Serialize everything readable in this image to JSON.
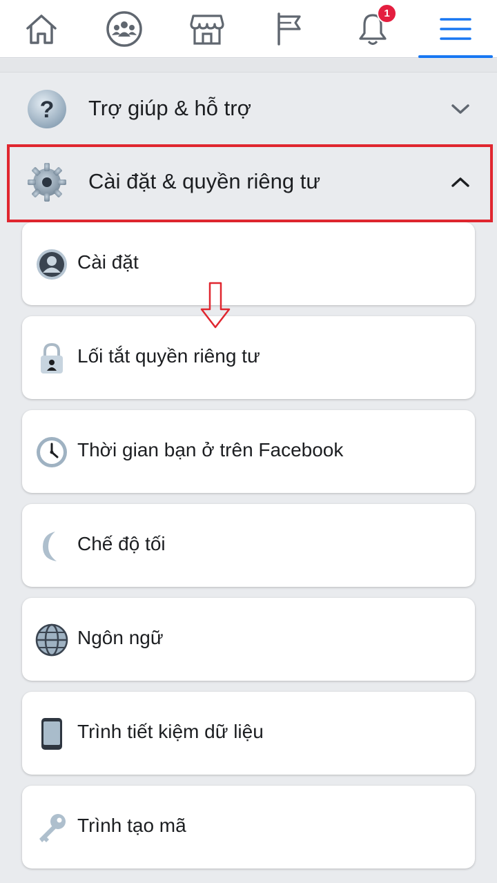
{
  "nav": {
    "tabs": [
      {
        "name": "home",
        "icon": "home-icon"
      },
      {
        "name": "groups",
        "icon": "groups-icon"
      },
      {
        "name": "marketplace",
        "icon": "marketplace-icon"
      },
      {
        "name": "pages",
        "icon": "flag-icon"
      },
      {
        "name": "notifications",
        "icon": "bell-icon"
      },
      {
        "name": "menu",
        "icon": "menu-icon"
      }
    ],
    "notification_count": "1",
    "active_tab": "menu",
    "accent_color": "#1877f2",
    "badge_color": "#e41e3f"
  },
  "sections": {
    "help": {
      "label": "Trợ giúp & hỗ trợ",
      "icon": "question-icon",
      "expanded": false
    },
    "settings": {
      "label": "Cài đặt & quyền riêng tư",
      "icon": "gear-icon",
      "expanded": true
    }
  },
  "settings_items": [
    {
      "label": "Cài đặt",
      "icon": "profile-icon"
    },
    {
      "label": "Lối tắt quyền riêng tư",
      "icon": "lock-icon"
    },
    {
      "label": "Thời gian bạn ở trên Facebook",
      "icon": "clock-icon"
    },
    {
      "label": "Chế độ tối",
      "icon": "moon-icon"
    },
    {
      "label": "Ngôn ngữ",
      "icon": "globe-icon"
    },
    {
      "label": "Trình tiết kiệm dữ liệu",
      "icon": "phone-icon"
    },
    {
      "label": "Trình tạo mã",
      "icon": "key-icon"
    }
  ],
  "annotation": {
    "highlight_color": "#e0262f",
    "arrow_icon": "down-arrow-icon"
  }
}
